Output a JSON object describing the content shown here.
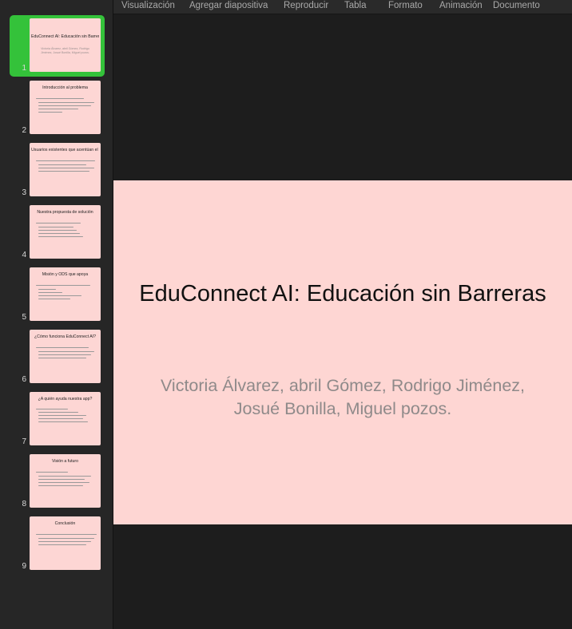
{
  "menu": [
    "Visualización",
    "Agregar diapositiva",
    "Reproducir",
    "Tabla",
    "Formato",
    "Animación",
    "Documento"
  ],
  "slides": [
    {
      "num": "1",
      "title": "EduConnect AI: Educación sin Barreras",
      "subtitle": "Victoria Álvarez, abril Gómez, Rodrigo Jiménez, Josué Bonilla, Miguel pozos."
    },
    {
      "num": "2",
      "title": "Introducción al problema"
    },
    {
      "num": "3",
      "title": "Usuarios existentes que acentúan el problema"
    },
    {
      "num": "4",
      "title": "Nuestra propuesta de solución"
    },
    {
      "num": "5",
      "title": "Misión y ODS que apoya"
    },
    {
      "num": "6",
      "title": "¿Cómo funciona EduConnect AI?"
    },
    {
      "num": "7",
      "title": "¿A quién ayuda nuestra app?"
    },
    {
      "num": "8",
      "title": "Visión a futuro"
    },
    {
      "num": "9",
      "title": "Conclusión"
    }
  ],
  "current_slide": {
    "title": "EduConnect AI: Educación sin Barreras",
    "subtitle": "Victoria Álvarez, abril Gómez, Rodrigo Jiménez, Josué Bonilla, Miguel pozos."
  },
  "colors": {
    "slide_bg": "#fed6d3",
    "selection": "#34c23a",
    "app_bg": "#1d1d1d"
  }
}
